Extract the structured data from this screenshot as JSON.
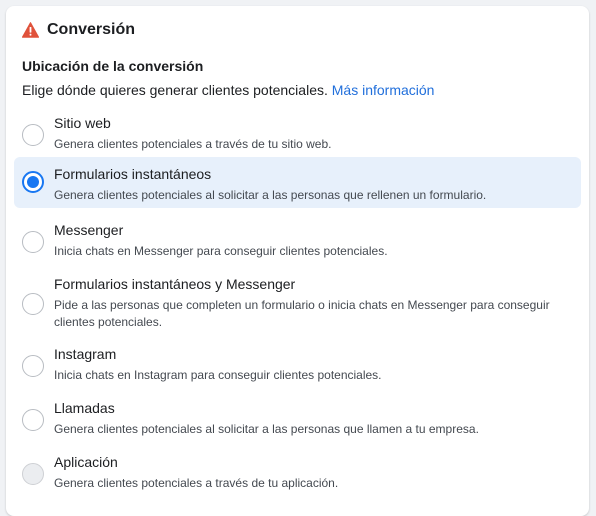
{
  "header": {
    "title": "Conversión",
    "icon": "warning-icon",
    "icon_color": "#e0523b"
  },
  "section": {
    "label": "Ubicación de la conversión",
    "description": "Elige dónde quieres generar clientes potenciales.",
    "link": "Más información",
    "link_color": "#216fdb"
  },
  "options": [
    {
      "title": "Sitio web",
      "subtitle": "Genera clientes potenciales a través de tu sitio web.",
      "selected": false,
      "disabled": false
    },
    {
      "title": "Formularios instantáneos",
      "subtitle": "Genera clientes potenciales al solicitar a las personas que rellenen un formulario.",
      "selected": true,
      "disabled": false
    },
    {
      "title": "Messenger",
      "subtitle": "Inicia chats en Messenger para conseguir clientes potenciales.",
      "selected": false,
      "disabled": false
    },
    {
      "title": "Formularios instantáneos y Messenger",
      "subtitle": "Pide a las personas que completen un formulario o inicia chats en Messenger para conseguir clientes potenciales.",
      "selected": false,
      "disabled": false
    },
    {
      "title": "Instagram",
      "subtitle": "Inicia chats en Instagram para conseguir clientes potenciales.",
      "selected": false,
      "disabled": false
    },
    {
      "title": "Llamadas",
      "subtitle": "Genera clientes potenciales al solicitar a las personas que llamen a tu empresa.",
      "selected": false,
      "disabled": false
    },
    {
      "title": "Aplicación",
      "subtitle": "Genera clientes potenciales a través de tu aplicación.",
      "selected": false,
      "disabled": true
    }
  ],
  "colors": {
    "selected_background": "#e7f0fb",
    "radio_accent": "#1877f2"
  }
}
